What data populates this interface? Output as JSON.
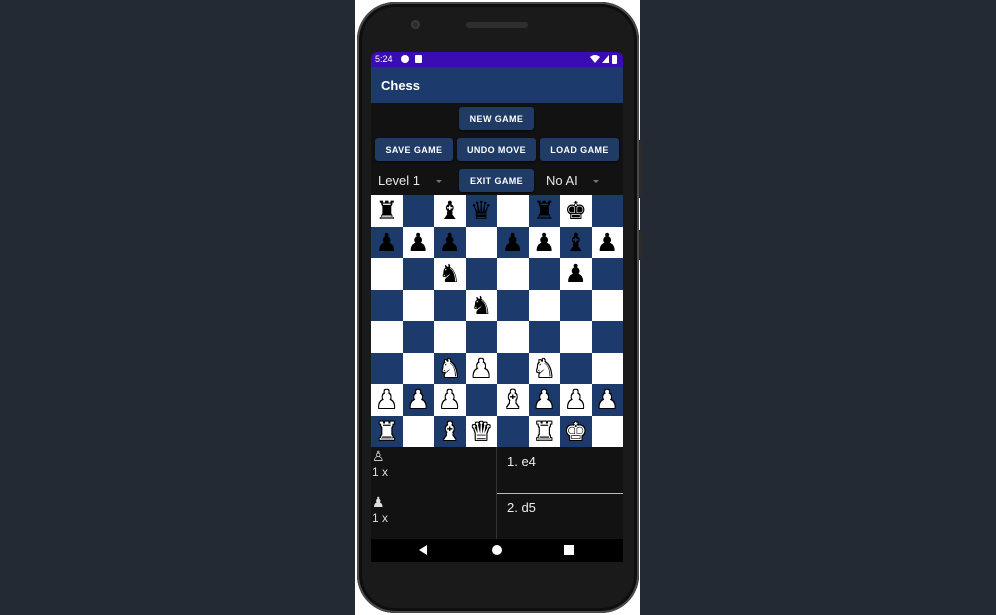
{
  "status_bar": {
    "time": "5:24",
    "icons": [
      "game-notification-icon",
      "sd-card-icon",
      "wifi-icon",
      "signal-icon",
      "battery-icon"
    ]
  },
  "app_bar": {
    "title": "Chess"
  },
  "controls": {
    "new_game": "NEW GAME",
    "save_game": "SAVE GAME",
    "undo_move": "UNDO MOVE",
    "load_game": "LOAD GAME",
    "exit_game": "EXIT GAME",
    "level_select": "Level 1",
    "ai_select": "No AI"
  },
  "colors": {
    "light_square": "#ffffff",
    "dark_square": "#1c3a6b",
    "button": "#1f3b66",
    "status_bar": "#3a0db3",
    "app_bar": "#1c3a6b"
  },
  "board": [
    [
      "bR",
      "",
      "bB",
      "bQ",
      "",
      "bR",
      "bK",
      ""
    ],
    [
      "bP",
      "bP",
      "bP",
      "",
      "bP",
      "bP",
      "bB",
      "bP"
    ],
    [
      "",
      "",
      "bN",
      "",
      "",
      "",
      "bP",
      ""
    ],
    [
      "",
      "",
      "",
      "bN",
      "",
      "",
      "",
      ""
    ],
    [
      "",
      "",
      "",
      "",
      "",
      "",
      "",
      ""
    ],
    [
      "",
      "",
      "wN",
      "wP",
      "",
      "wN",
      "",
      ""
    ],
    [
      "wP",
      "wP",
      "wP",
      "",
      "wB",
      "wP",
      "wP",
      "wP"
    ],
    [
      "wR",
      "",
      "wB",
      "wQ",
      "",
      "wR",
      "wK",
      ""
    ]
  ],
  "captured": {
    "white_piece": "♙",
    "white_count": "1 x",
    "black_piece": "♟",
    "black_count": "1 x"
  },
  "moves": [
    "1. e4",
    "2. d5"
  ]
}
